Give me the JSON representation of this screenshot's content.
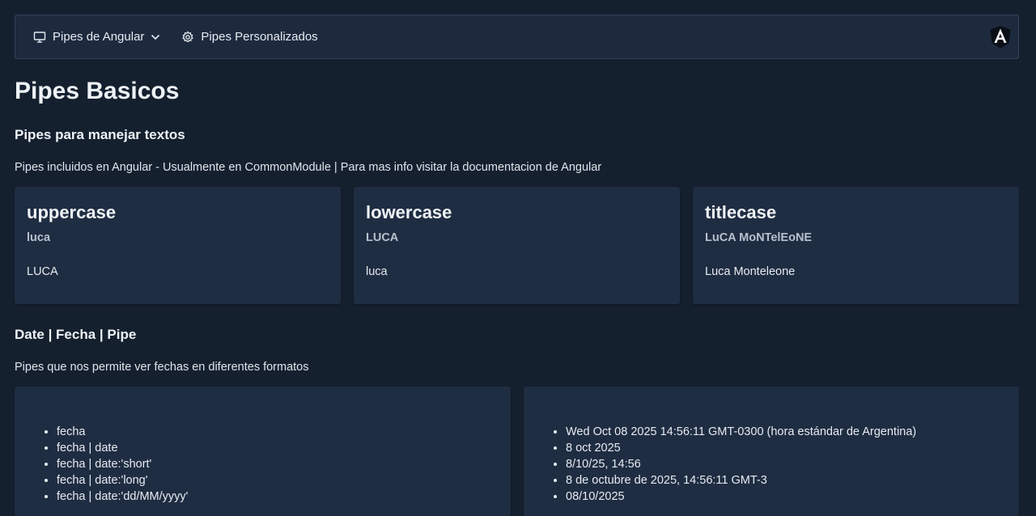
{
  "navbar": {
    "items": [
      {
        "label": "Pipes de Angular",
        "icon": "monitor-icon"
      },
      {
        "label": "Pipes Personalizados",
        "icon": "gear-icon"
      }
    ],
    "logo": "angular-logo"
  },
  "page": {
    "title": "Pipes Basicos",
    "text_section": {
      "heading": "Pipes para manejar textos",
      "description": "Pipes incluidos en Angular - Usualmente en CommonModule | Para mas info visitar la documentacion de Angular",
      "cards": [
        {
          "title": "uppercase",
          "input": "luca",
          "output": "LUCA"
        },
        {
          "title": "lowercase",
          "input": "LUCA",
          "output": "luca"
        },
        {
          "title": "titlecase",
          "input": "LuCA MoNTelEoNE",
          "output": "Luca Monteleone"
        }
      ]
    },
    "date_section": {
      "heading": "Date | Fecha | Pipe",
      "description": "Pipes que nos permite ver fechas en diferentes formatos",
      "expressions": [
        "fecha",
        "fecha | date",
        "fecha | date:'short'",
        "fecha | date:'long'",
        "fecha | date:'dd/MM/yyyy'"
      ],
      "results": [
        "Wed Oct 08 2025 14:56:11 GMT-0300 (hora estándar de Argentina)",
        "8 oct 2025",
        "8/10/25, 14:56",
        "8 de octubre de 2025, 14:56:11 GMT-3",
        "08/10/2025"
      ]
    }
  }
}
